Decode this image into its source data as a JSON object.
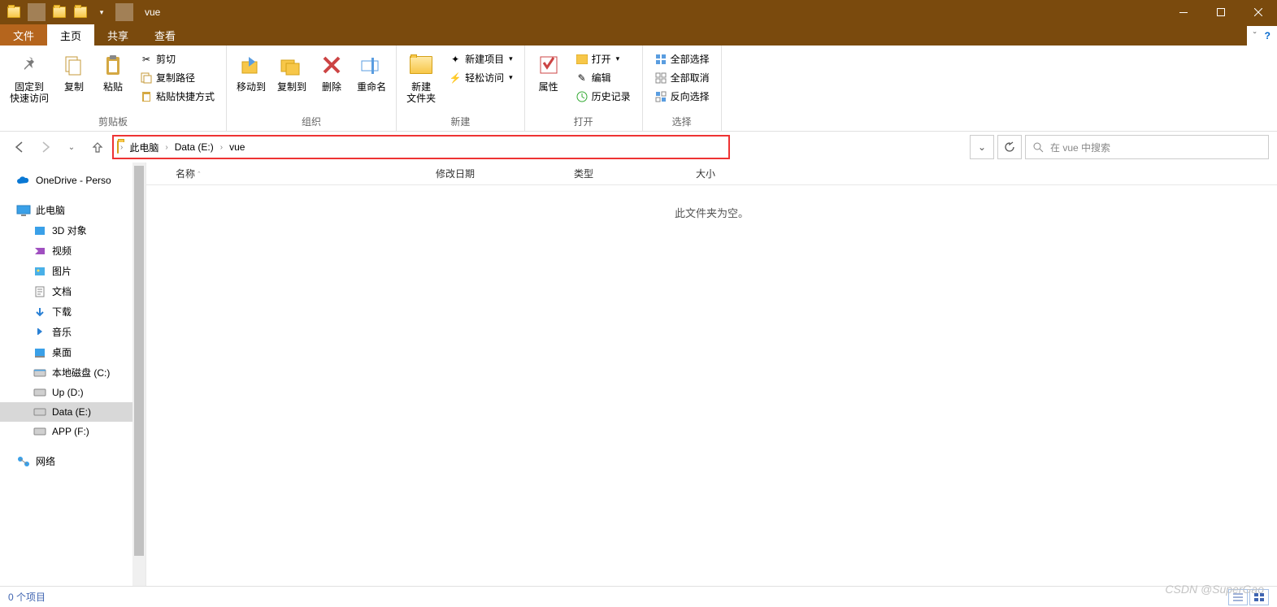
{
  "title": "vue",
  "tabs": {
    "file": "文件",
    "home": "主页",
    "share": "共享",
    "view": "查看"
  },
  "ribbon": {
    "pin": "固定到\n快速访问",
    "copy": "复制",
    "paste": "粘贴",
    "cut": "剪切",
    "copypath": "复制路径",
    "pasteshortcut": "粘贴快捷方式",
    "clipboard": "剪贴板",
    "moveto": "移动到",
    "copyto": "复制到",
    "delete": "删除",
    "rename": "重命名",
    "organize": "组织",
    "newfolder": "新建\n文件夹",
    "newitem": "新建项目",
    "easyaccess": "轻松访问",
    "new": "新建",
    "properties": "属性",
    "open_": "打开",
    "edit": "编辑",
    "history": "历史记录",
    "open": "打开",
    "selectall": "全部选择",
    "selectnone": "全部取消",
    "invert": "反向选择",
    "select": "选择"
  },
  "breadcrumb": {
    "pc": "此电脑",
    "drive": "Data (E:)",
    "folder": "vue"
  },
  "search_placeholder": "在 vue 中搜索",
  "columns": {
    "name": "名称",
    "modified": "修改日期",
    "type": "类型",
    "size": "大小"
  },
  "empty": "此文件夹为空。",
  "nav": {
    "onedrive": "OneDrive - Perso",
    "pc": "此电脑",
    "items": [
      "3D 对象",
      "视频",
      "图片",
      "文档",
      "下载",
      "音乐",
      "桌面",
      "本地磁盘 (C:)",
      "Up (D:)",
      "Data (E:)",
      "APP (F:)"
    ],
    "network": "网络"
  },
  "status": "0 个项目",
  "watermark": "CSDN @SuperGao"
}
